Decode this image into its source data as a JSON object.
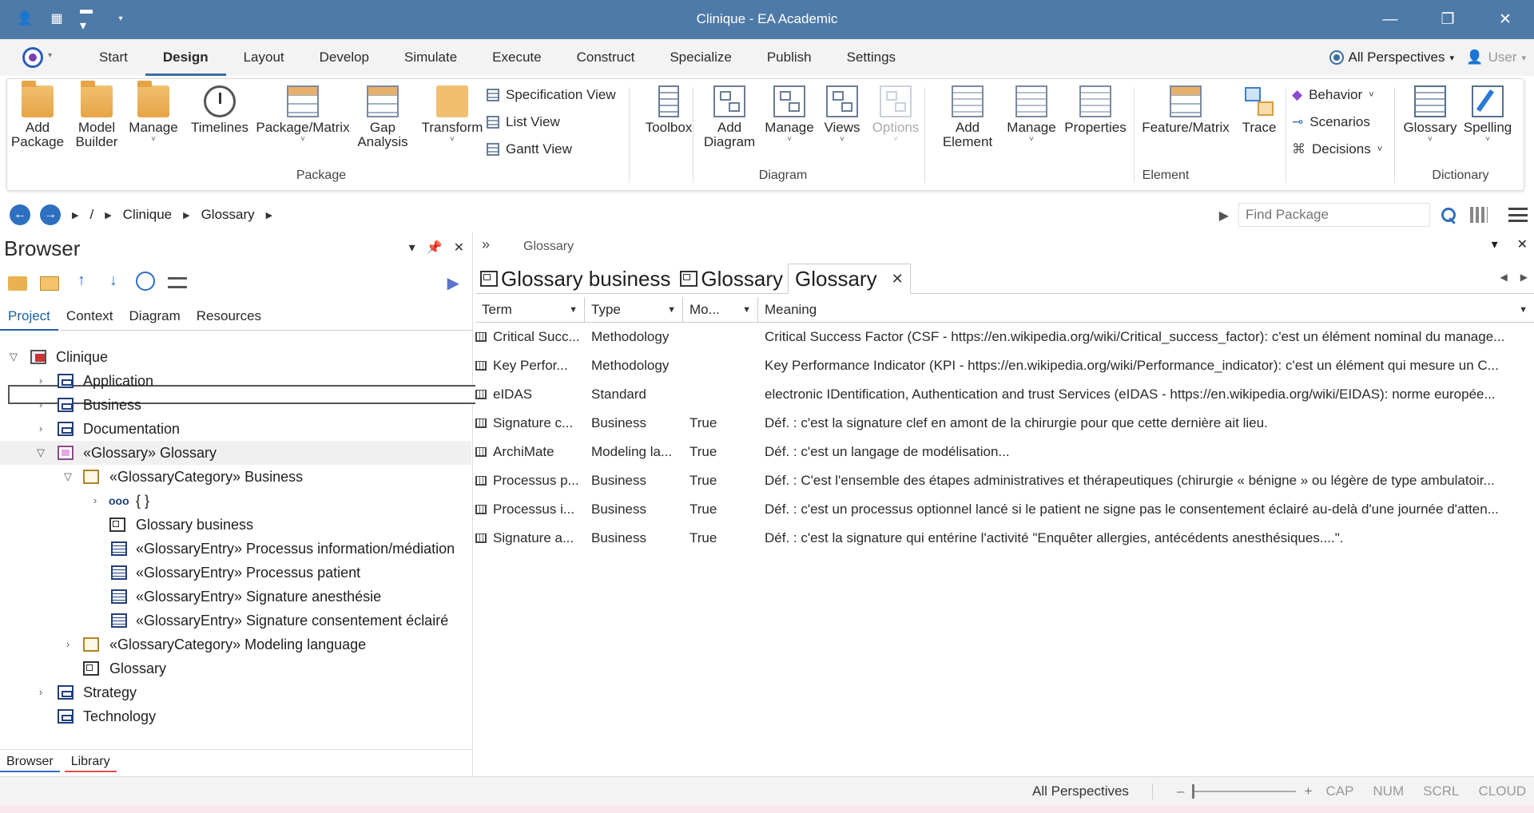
{
  "window": {
    "title": "Clinique - EA Academic"
  },
  "menu": {
    "tabs": [
      "Start",
      "Design",
      "Layout",
      "Develop",
      "Simulate",
      "Execute",
      "Construct",
      "Specialize",
      "Publish",
      "Settings"
    ],
    "active": "Design",
    "perspectives": "All Perspectives",
    "user": "User"
  },
  "ribbon": {
    "package": {
      "group_label": "Package",
      "add_package": "Add\nPackage",
      "model_builder": "Model\nBuilder",
      "manage": "Manage",
      "timelines": "Timelines",
      "package_matrix": "Package/Matrix",
      "gap_analysis": "Gap\nAnalysis",
      "transform": "Transform",
      "specification_view": "Specification View",
      "list_view": "List View",
      "gantt_view": "Gantt View"
    },
    "diagram": {
      "group_label": "Diagram",
      "toolbox": "Toolbox",
      "add_diagram": "Add\nDiagram",
      "manage": "Manage",
      "views": "Views",
      "options": "Options"
    },
    "element": {
      "group_label": "Element",
      "add_element": "Add\nElement",
      "manage": "Manage",
      "properties": "Properties",
      "feature_matrix": "Feature/Matrix",
      "trace": "Trace",
      "behavior": "Behavior",
      "scenarios": "Scenarios",
      "decisions": "Decisions"
    },
    "dictionary": {
      "group_label": "Dictionary",
      "glossary": "Glossary",
      "spelling": "Spelling"
    }
  },
  "address": {
    "root": "/",
    "crumbs": [
      "Clinique",
      "Glossary"
    ],
    "find_placeholder": "Find Package"
  },
  "browser": {
    "title": "Browser",
    "tabs": [
      "Project",
      "Context",
      "Diagram",
      "Resources"
    ],
    "active_tab": "Project",
    "tree": [
      {
        "label": "Clinique"
      },
      {
        "label": "Application"
      },
      {
        "label": "Business"
      },
      {
        "label": "Documentation"
      },
      {
        "label": "«Glossary» Glossary"
      },
      {
        "label": "«GlossaryCategory» Business"
      },
      {
        "label": "{ }"
      },
      {
        "label": "Glossary business"
      },
      {
        "label": "«GlossaryEntry» Processus information/médiation"
      },
      {
        "label": "«GlossaryEntry» Processus patient"
      },
      {
        "label": "«GlossaryEntry» Signature anesthésie"
      },
      {
        "label": "«GlossaryEntry» Signature consentement éclairé"
      },
      {
        "label": "«GlossaryCategory» Modeling language"
      },
      {
        "label": "Glossary"
      },
      {
        "label": "Strategy"
      },
      {
        "label": "Technology"
      }
    ],
    "bottom_tabs": [
      "Browser",
      "Library"
    ]
  },
  "main": {
    "breadcrumb": "Glossary",
    "doc_tabs": [
      "Glossary business",
      "Glossary",
      "Glossary"
    ],
    "columns": [
      "Term",
      "Type",
      "Mo...",
      "Meaning"
    ],
    "rows": [
      {
        "term": "Critical Succ...",
        "type": "Methodology",
        "mo": "",
        "meaning": "Critical Success Factor (CSF - https://en.wikipedia.org/wiki/Critical_success_factor): c'est un élément nominal du manage..."
      },
      {
        "term": "Key Perfor...",
        "type": "Methodology",
        "mo": "",
        "meaning": "Key Performance Indicator (KPI - https://en.wikipedia.org/wiki/Performance_indicator): c'est un élément qui mesure un C..."
      },
      {
        "term": "eIDAS",
        "type": "Standard",
        "mo": "",
        "meaning": "electronic IDentification, Authentication and trust Services (eIDAS - https://en.wikipedia.org/wiki/EIDAS): norme europée..."
      },
      {
        "term": "Signature c...",
        "type": "Business",
        "mo": "True",
        "meaning": "Déf. : c'est la signature clef en amont de la chirurgie pour que cette dernière ait lieu."
      },
      {
        "term": "ArchiMate",
        "type": "Modeling la...",
        "mo": "True",
        "meaning": "Déf. : c'est un langage de modélisation..."
      },
      {
        "term": "Processus p...",
        "type": "Business",
        "mo": "True",
        "meaning": "Déf. : C'est l'ensemble des étapes administratives et thérapeutiques (chirurgie « bénigne » ou légère de type ambulatoir..."
      },
      {
        "term": "Processus i...",
        "type": "Business",
        "mo": "True",
        "meaning": "Déf. : c'est un processus optionnel lancé si le patient ne signe pas le consentement éclairé au-delà d'une journée d'atten..."
      },
      {
        "term": "Signature a...",
        "type": "Business",
        "mo": "True",
        "meaning": "Déf. : c'est la signature qui entérine l'activité \"Enquêter allergies, antécédents anesthésiques....\"."
      }
    ]
  },
  "status": {
    "perspectives": "All Perspectives",
    "zoom_minus": "–",
    "zoom_plus": "+",
    "keys": [
      "CAP",
      "NUM",
      "SCRL",
      "CLOUD"
    ]
  }
}
